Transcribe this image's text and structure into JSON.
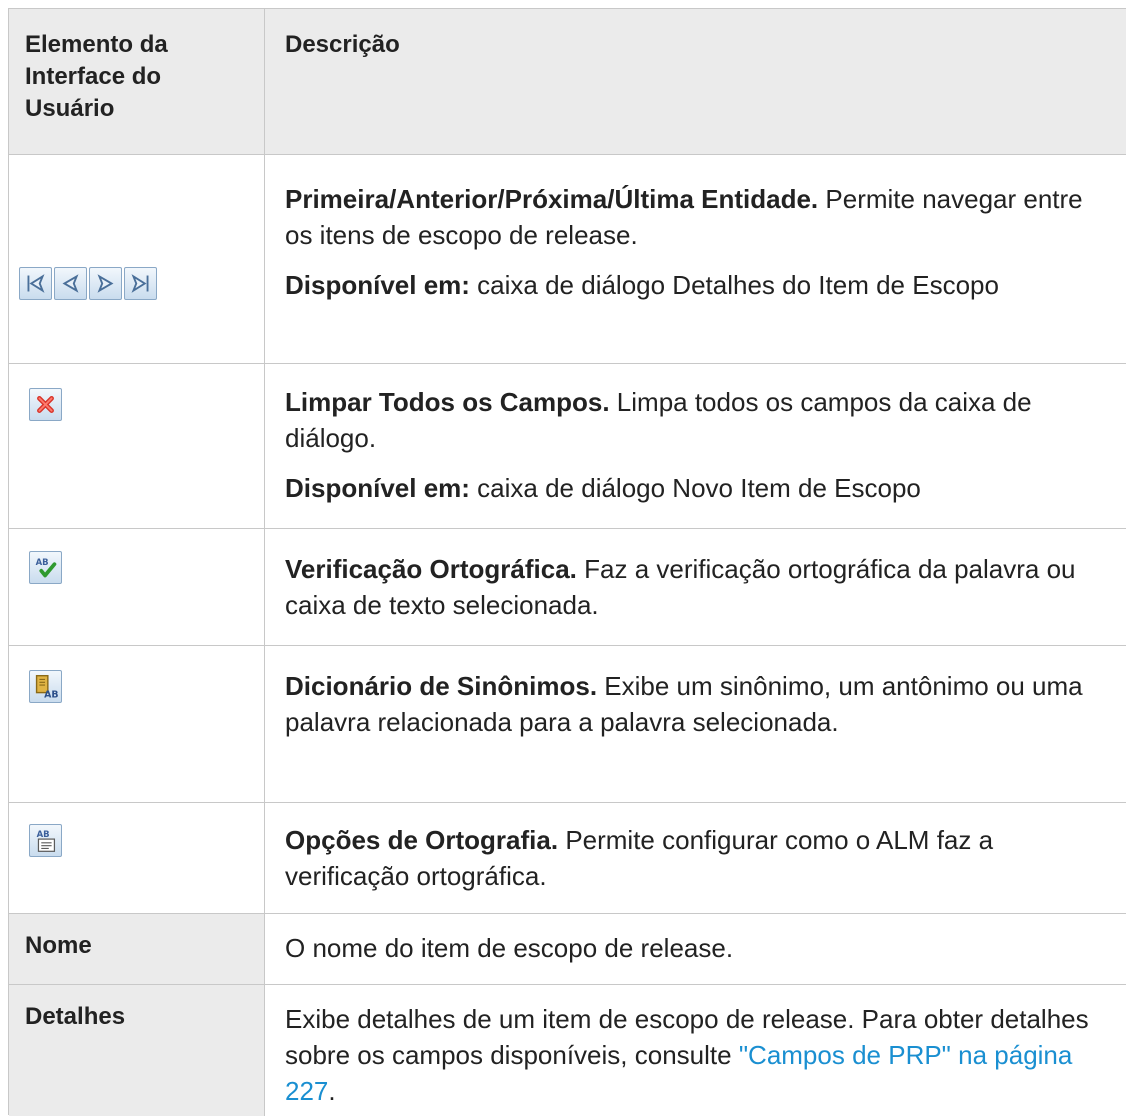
{
  "header": {
    "col1": "Elemento da Interface do Usuário",
    "col2": "Descrição"
  },
  "rows": [
    {
      "icons": [
        "first-entity-icon",
        "previous-entity-icon",
        "next-entity-icon",
        "last-entity-icon"
      ],
      "title": "Primeira/Anterior/Próxima/Última Entidade.",
      "text": "Permite navegar entre os itens de escopo de release.",
      "avail_label": "Disponível em:",
      "avail_text": "caixa de diálogo Detalhes do Item de Escopo"
    },
    {
      "icons": [
        "clear-all-fields-icon"
      ],
      "title": "Limpar Todos os Campos.",
      "text": "Limpa todos os campos da caixa de diálogo.",
      "avail_label": "Disponível em:",
      "avail_text": "caixa de diálogo Novo Item de Escopo"
    },
    {
      "icons": [
        "spell-check-icon"
      ],
      "title": "Verificação Ortográfica.",
      "text": "Faz a verificação ortográfica da palavra ou caixa de texto selecionada."
    },
    {
      "icons": [
        "thesaurus-icon"
      ],
      "title": "Dicionário de Sinônimos.",
      "text": "Exibe um sinônimo, um antônimo ou uma palavra relacionada para a palavra selecionada."
    },
    {
      "icons": [
        "spelling-options-icon"
      ],
      "title": "Opções de Ortografia.",
      "text": "Permite configurar como o ALM faz a verificação ortográfica."
    },
    {
      "name": "Nome",
      "text": "O nome do item de escopo de release."
    },
    {
      "name": "Detalhes",
      "text": "Exibe detalhes de um item de escopo de release. Para obter detalhes sobre os campos disponíveis, consulte",
      "link": "\"Campos de PRP\" na página 227",
      "suffix": "."
    }
  ],
  "colors": {
    "header_bg": "#ebebeb",
    "border": "#c8c8c8",
    "link": "#1a8fd1"
  }
}
